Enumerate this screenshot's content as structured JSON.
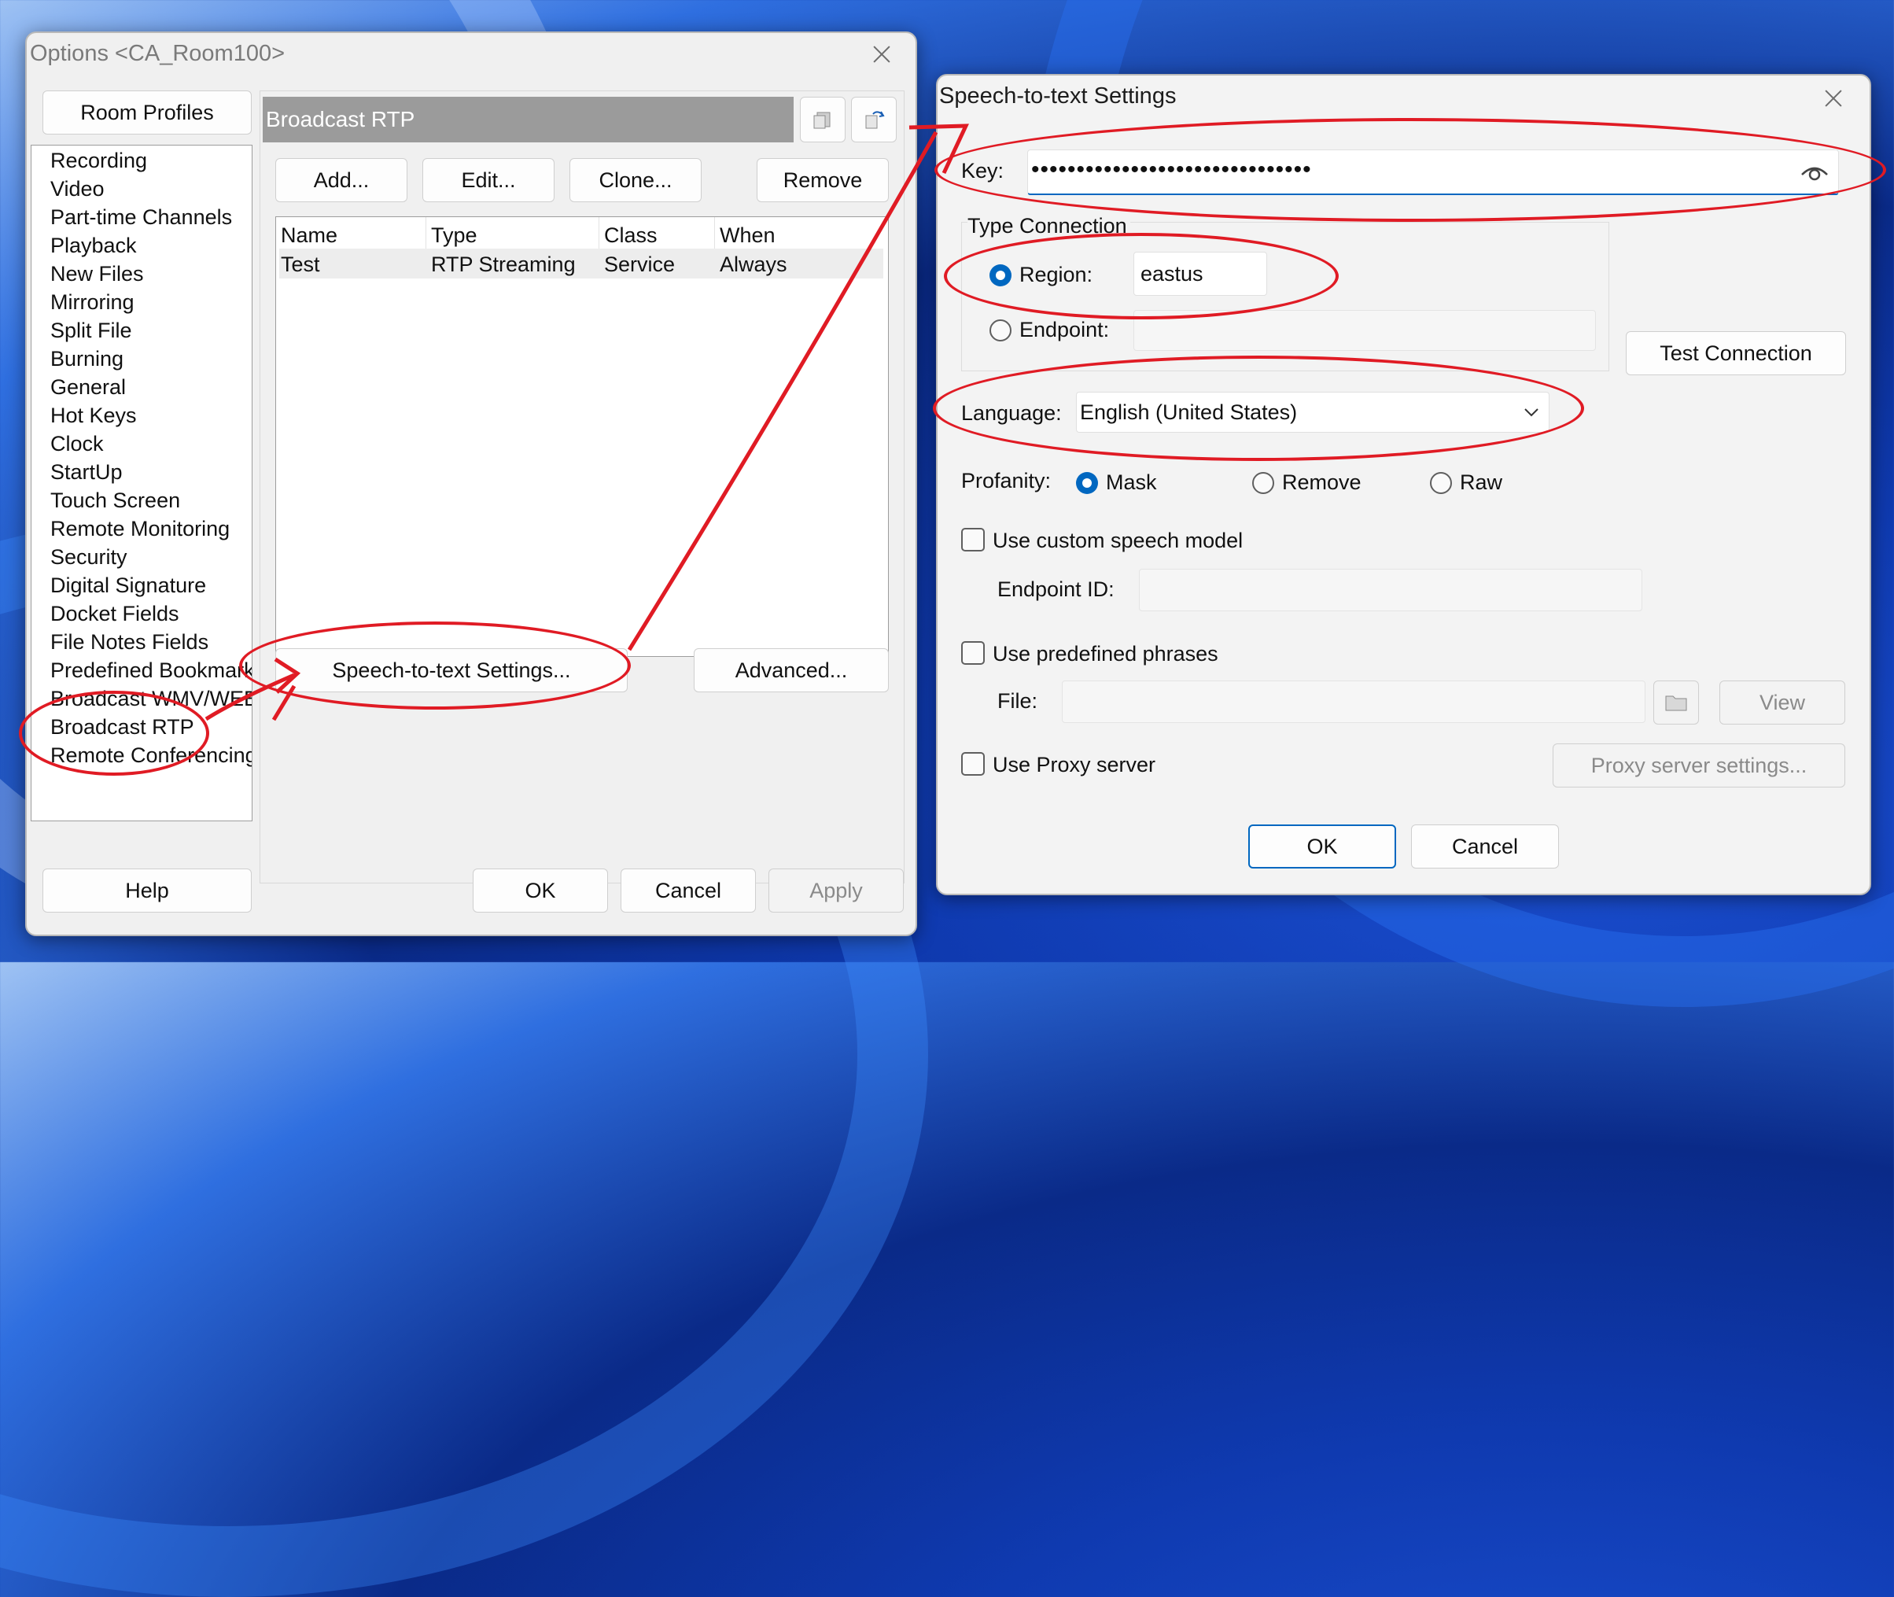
{
  "options_window": {
    "title": "Options <CA_Room100>",
    "room_profiles_label": "Room Profiles",
    "nav_items": [
      "Recording",
      "Video",
      "Part-time Channels",
      "Playback",
      "New Files",
      "Mirroring",
      "Split File",
      "Burning",
      "General",
      "Hot Keys",
      "Clock",
      "StartUp",
      "Touch Screen",
      "Remote Monitoring",
      "Security",
      "Digital Signature",
      "Docket Fields",
      "File Notes Fields",
      "Predefined Bookmark",
      "Broadcast WMV/WEB",
      "Broadcast RTP",
      "Remote Conferencing"
    ],
    "section_title": "Broadcast RTP",
    "add_label": "Add...",
    "edit_label": "Edit...",
    "clone_label": "Clone...",
    "remove_label": "Remove",
    "table": {
      "columns": [
        "Name",
        "Type",
        "Class",
        "When"
      ],
      "rows": [
        [
          "Test",
          "RTP Streaming",
          "Service",
          "Always"
        ]
      ]
    },
    "speech_settings_label": "Speech-to-text Settings...",
    "advanced_label": "Advanced...",
    "help_label": "Help",
    "ok_label": "OK",
    "cancel_label": "Cancel",
    "apply_label": "Apply"
  },
  "speech_dialog": {
    "title": "Speech-to-text Settings",
    "key_label": "Key:",
    "key_value": "•••••••••••••••••••••••••••••••",
    "type_connection_label": "Type Connection",
    "region_label": "Region:",
    "region_value": "eastus",
    "endpoint_label": "Endpoint:",
    "test_connection_label": "Test Connection",
    "language_label": "Language:",
    "language_value": "English (United States)",
    "profanity_label": "Profanity:",
    "profanity_options": [
      "Mask",
      "Remove",
      "Raw"
    ],
    "custom_model_label": "Use custom speech model",
    "endpoint_id_label": "Endpoint ID:",
    "predefined_phrases_label": "Use predefined phrases",
    "file_label": "File:",
    "view_label": "View",
    "proxy_label": "Use Proxy server",
    "proxy_settings_label": "Proxy server settings...",
    "ok_label": "OK",
    "cancel_label": "Cancel"
  },
  "colors": {
    "accent": "#0067c0",
    "annotation": "#e01b24",
    "header_bar": "#9b9b9b"
  }
}
